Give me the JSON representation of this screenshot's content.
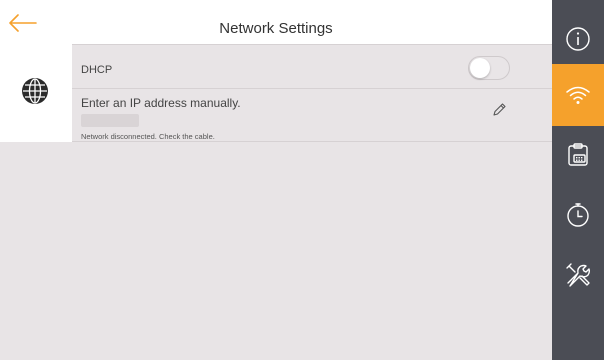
{
  "header": {
    "title": "Network Settings",
    "back_icon": "arrow-left-icon"
  },
  "network": {
    "dhcp_label": "DHCP",
    "dhcp_enabled": false,
    "manual_label": "Enter an IP address manually.",
    "status": "Network disconnected. Check the cable."
  },
  "sidebar": {
    "items": [
      {
        "icon": "info-icon",
        "active": false
      },
      {
        "icon": "wifi-icon",
        "active": true
      },
      {
        "icon": "device-icon",
        "active": false
      },
      {
        "icon": "timer-icon",
        "active": false
      },
      {
        "icon": "tools-icon",
        "active": false
      }
    ]
  },
  "colors": {
    "accent": "#f5a12c",
    "sidebar_bg": "#4b4d55",
    "content_bg": "#e8e4e6"
  }
}
